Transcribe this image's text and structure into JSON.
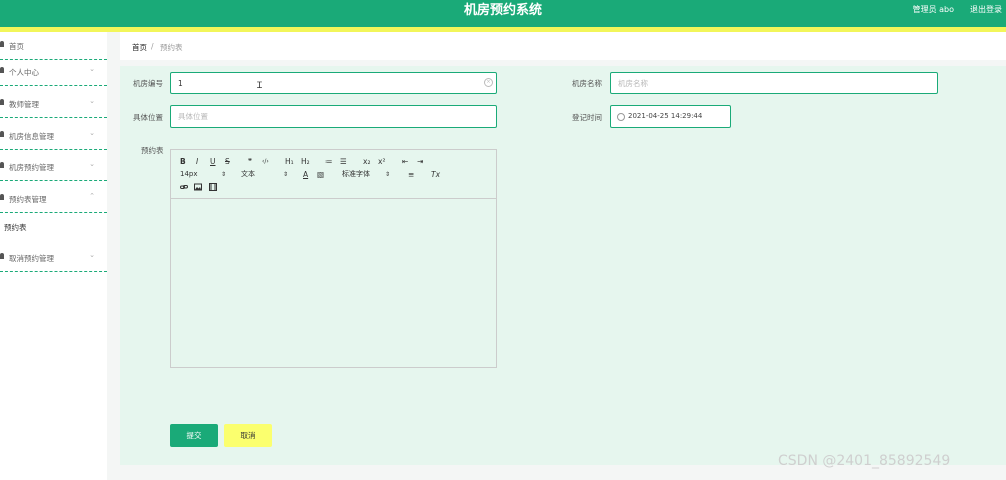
{
  "header": {
    "title": "机房预约系统",
    "user": "管理员 abo",
    "logout": "退出登录"
  },
  "sidebar": {
    "items": [
      {
        "label": "首页",
        "chevron": ""
      },
      {
        "label": "个人中心",
        "chevron": "⌄"
      },
      {
        "label": "教师管理",
        "chevron": "⌄"
      },
      {
        "label": "机房信息管理",
        "chevron": "⌄"
      },
      {
        "label": "机房预约管理",
        "chevron": "⌄"
      },
      {
        "label": "预约表管理",
        "chevron": "⌃"
      },
      {
        "label": "取消预约管理",
        "chevron": "⌄"
      }
    ],
    "subitem": "预约表"
  },
  "breadcrumb": {
    "home": "首页",
    "separator": "/",
    "current": "预约表"
  },
  "form": {
    "room_no_label": "机房编号",
    "room_no_value": "1",
    "room_name_label": "机房名称",
    "room_name_placeholder": "机房名称",
    "location_label": "具体位置",
    "location_placeholder": "具体位置",
    "register_time_label": "登记时间",
    "register_time_value": "2021-04-25 14:29:44",
    "table_label": "预约表"
  },
  "editor_toolbar": {
    "row1": [
      "B",
      "I",
      "U",
      "S",
      "❞",
      "‹/›",
      "H₁",
      "H₂",
      "≔",
      "☰",
      "x₂",
      "x²",
      "⇤",
      "⇥"
    ],
    "size": "14px",
    "text": "文本",
    "color": "A",
    "background": "▧",
    "font": "标准字体",
    "align": "≡",
    "clear": "Tx",
    "row3": [
      "link",
      "image",
      "video"
    ]
  },
  "buttons": {
    "submit": "提交",
    "cancel": "取消"
  },
  "watermark": "CSDN @2401_85892549",
  "colors": {
    "primary": "#1aaa78",
    "accent_yellow": "#f2f65a",
    "panel_bg": "#e6f6ee"
  }
}
